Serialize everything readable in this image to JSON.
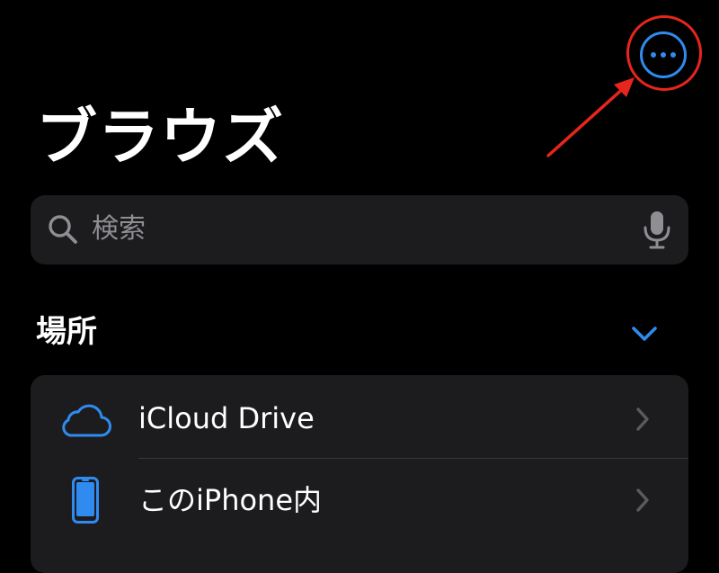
{
  "header": {
    "more_button_icon": "ellipsis-circle-icon",
    "title": "ブラウズ"
  },
  "search": {
    "placeholder": "検索",
    "search_icon": "magnifying-glass-icon",
    "mic_icon": "microphone-icon"
  },
  "locations": {
    "section_title": "場所",
    "collapse_icon": "chevron-down-icon",
    "items": [
      {
        "label": "iCloud Drive",
        "icon": "cloud-icon"
      },
      {
        "label": "このiPhone内",
        "icon": "iphone-icon"
      }
    ]
  },
  "colors": {
    "accent": "#2f8bf0",
    "annotation": "#e8251c",
    "background": "#000000",
    "card": "#1c1c1e",
    "secondary_text": "#8e8e93"
  }
}
